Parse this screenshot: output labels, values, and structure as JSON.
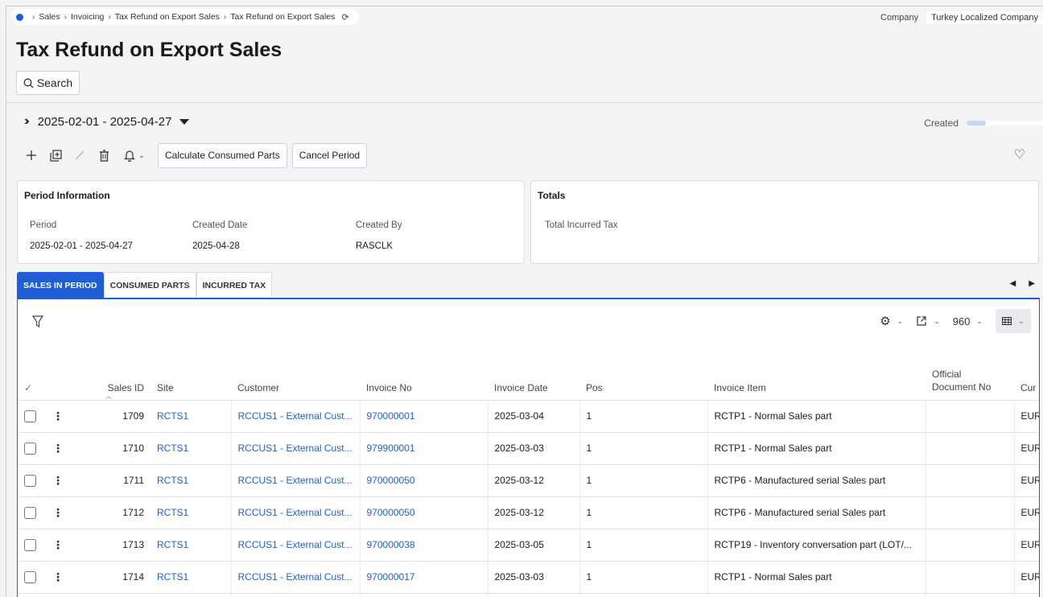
{
  "breadcrumb": {
    "items": [
      "Sales",
      "Invoicing",
      "Tax Refund on Export Sales",
      "Tax Refund on Export Sales"
    ]
  },
  "company": {
    "label": "Company",
    "value": "Turkey Localized Company"
  },
  "page": {
    "title": "Tax Refund on Export Sales"
  },
  "search": {
    "label": "Search"
  },
  "period_selector": {
    "value": "2025-02-01 - 2025-04-27"
  },
  "status": {
    "label": "Created",
    "progress": 0.25
  },
  "toolbar": {
    "calculate_label": "Calculate Consumed Parts",
    "cancel_label": "Cancel Period"
  },
  "period_info": {
    "title": "Period Information",
    "fields": [
      {
        "label": "Period",
        "value": "2025-02-01 - 2025-04-27"
      },
      {
        "label": "Created Date",
        "value": "2025-04-28"
      },
      {
        "label": "Created By",
        "value": "RASCLK"
      }
    ]
  },
  "totals": {
    "title": "Totals",
    "fields": [
      {
        "label": "Total Incurred Tax",
        "value": ""
      }
    ]
  },
  "tabs": [
    {
      "label": "SALES IN PERIOD",
      "active": true
    },
    {
      "label": "CONSUMED PARTS",
      "active": false
    },
    {
      "label": "INCURRED TAX",
      "active": false
    }
  ],
  "grid": {
    "page_size": "960",
    "columns": [
      "Sales ID",
      "Site",
      "Customer",
      "Invoice No",
      "Invoice Date",
      "Pos",
      "Invoice Item",
      "Official Document No",
      "Cur"
    ],
    "rows": [
      {
        "sales_id": "1709",
        "site": "RCTS1",
        "customer": "RCCUS1 - External Cust...",
        "invoice_no": "970000001",
        "invoice_date": "2025-03-04",
        "pos": "1",
        "invoice_item": "RCTP1 - Normal Sales part",
        "official_doc": "",
        "cur": "EUR"
      },
      {
        "sales_id": "1710",
        "site": "RCTS1",
        "customer": "RCCUS1 - External Cust...",
        "invoice_no": "979900001",
        "invoice_date": "2025-03-03",
        "pos": "1",
        "invoice_item": "RCTP1 - Normal Sales part",
        "official_doc": "",
        "cur": "EUR"
      },
      {
        "sales_id": "1711",
        "site": "RCTS1",
        "customer": "RCCUS1 - External Cust...",
        "invoice_no": "970000050",
        "invoice_date": "2025-03-12",
        "pos": "1",
        "invoice_item": "RCTP6 - Manufactured serial Sales part",
        "official_doc": "",
        "cur": "EUR"
      },
      {
        "sales_id": "1712",
        "site": "RCTS1",
        "customer": "RCCUS1 - External Cust...",
        "invoice_no": "970000050",
        "invoice_date": "2025-03-12",
        "pos": "1",
        "invoice_item": "RCTP6 - Manufactured serial Sales part",
        "official_doc": "",
        "cur": "EUR"
      },
      {
        "sales_id": "1713",
        "site": "RCTS1",
        "customer": "RCCUS1 - External Cust...",
        "invoice_no": "970000038",
        "invoice_date": "2025-03-05",
        "pos": "1",
        "invoice_item": "RCTP19 - Inventory conversation part (LOT/...",
        "official_doc": "",
        "cur": "EUR"
      },
      {
        "sales_id": "1714",
        "site": "RCTS1",
        "customer": "RCCUS1 - External Cust...",
        "invoice_no": "970000017",
        "invoice_date": "2025-03-03",
        "pos": "1",
        "invoice_item": "RCTP1 - Normal Sales part",
        "official_doc": "",
        "cur": "EUR"
      },
      {
        "sales_id": "",
        "site": "",
        "customer": "",
        "invoice_no": "",
        "invoice_date": "",
        "pos": "",
        "invoice_item": "",
        "official_doc": "",
        "cur": ""
      }
    ]
  }
}
